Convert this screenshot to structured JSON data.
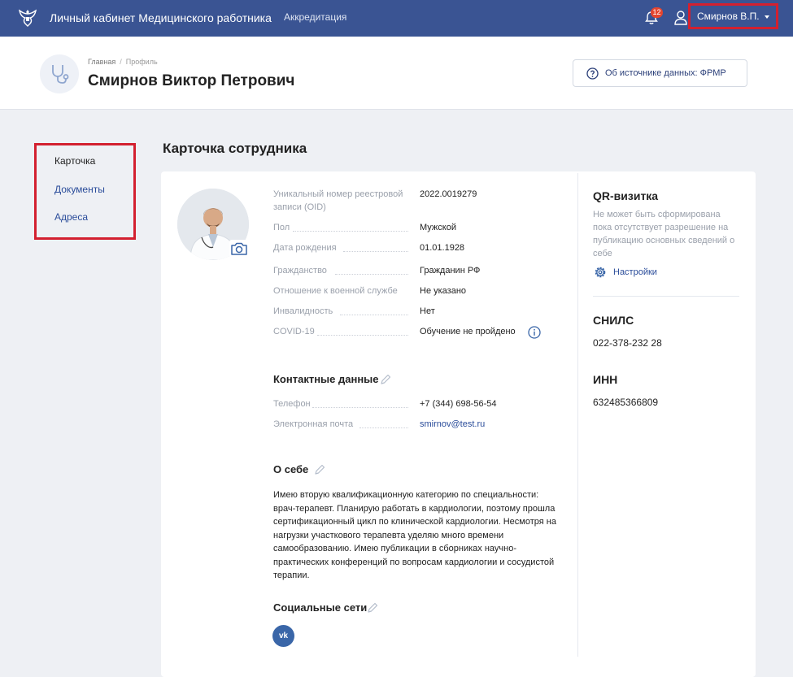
{
  "topbar": {
    "app_title": "Личный кабинет Медицинского работника",
    "nav_accreditation": "Аккредитация",
    "notifications_count": "12",
    "user_name": "Смирнов В.П."
  },
  "header": {
    "breadcrumb": {
      "home": "Главная",
      "current": "Профиль"
    },
    "title": "Смирнов Виктор Петрович",
    "source_button": "Об источнике данных: ФРМР"
  },
  "sidebar": {
    "items": [
      {
        "label": "Карточка",
        "active": true
      },
      {
        "label": "Документы",
        "active": false
      },
      {
        "label": "Адреса",
        "active": false
      }
    ]
  },
  "main": {
    "section_title": "Карточка сотрудника",
    "fields": [
      {
        "label_line1": "Уникальный номер реестровой",
        "label_line2": "записи (OID)",
        "value": "2022.0019279"
      },
      {
        "label": "Пол",
        "value": "Мужской"
      },
      {
        "label": "Дата рождения",
        "value": "01.01.1928"
      },
      {
        "label": "Гражданство",
        "value": "Гражданин РФ"
      },
      {
        "label": "Отношение к военной службе",
        "value": "Не указано"
      },
      {
        "label": "Инвалидность",
        "value": "Нет"
      },
      {
        "label": "COVID-19",
        "value": "Обучение не пройдено"
      }
    ],
    "contacts": {
      "title": "Контактные данные",
      "phone_label": "Телефон",
      "phone": "+7 (344) 698-56-54",
      "email_label": "Электронная почта",
      "email": "smirnov@test.ru"
    },
    "about": {
      "title": "О себе",
      "text": "Имею вторую квалификационную категорию по специальности: врач-терапевт. Планирую работать в кардиологии, поэтому прошла сертификационный цикл по клинической кардиологии. Несмотря на нагрузки участкового терапевта уделяю много времени самообразованию. Имею публикации в сборниках научно-практических конференций по вопросам кардиологии и сосудистой терапии."
    },
    "social": {
      "title": "Социальные сети",
      "vk": "vk"
    }
  },
  "right": {
    "qr_title": "QR-визитка",
    "qr_note": "Не может быть сформирована пока отсутствует разрешение на публикацию основных сведений о себе",
    "settings": "Настройки",
    "snils_title": "СНИЛС",
    "snils": "022-378-232 28",
    "inn_title": "ИНН",
    "inn": "632485366809"
  },
  "colors": {
    "topbar": "#3a5493",
    "accent_link": "#2a4c9a",
    "highlight_border": "#d3202f",
    "badge": "#e4452f"
  }
}
